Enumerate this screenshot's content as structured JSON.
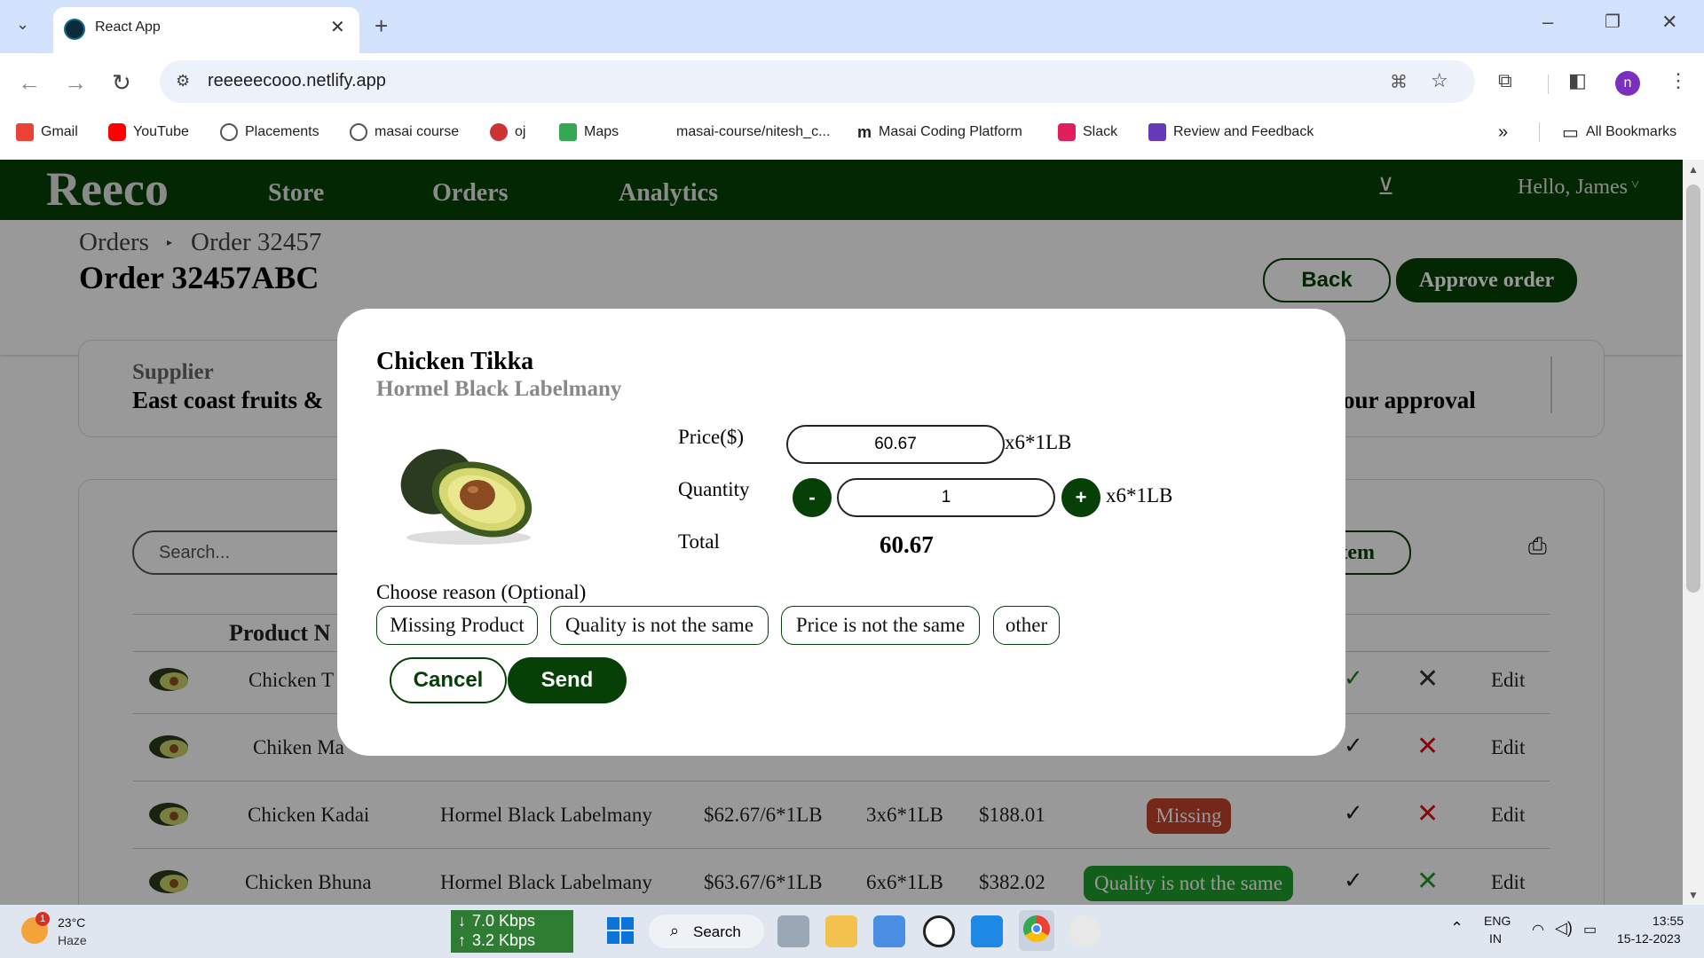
{
  "browser": {
    "tab_title": "React App",
    "url": "reeeeecooo.netlify.app",
    "profile_initial": "n",
    "bookmarks": [
      "Gmail",
      "YouTube",
      "Placements",
      "masai course",
      "oj",
      "Maps",
      "masai-course/nitesh_c...",
      "Masai Coding Platform",
      "Slack",
      "Review and Feedback"
    ],
    "all_bookmarks": "All Bookmarks"
  },
  "app": {
    "logo": "Reeco",
    "nav": [
      "Store",
      "Orders",
      "Analytics"
    ],
    "greeting": "Hello, James",
    "breadcrumb": [
      "Orders",
      "Order 32457"
    ],
    "order_title": "Order 32457ABC",
    "back_label": "Back",
    "approve_label": "Approve order",
    "supplier_label": "Supplier",
    "supplier_value": "East coast fruits &",
    "status_value": "our approval",
    "search_placeholder": "Search...",
    "add_item_partial": "Item",
    "product_header_partial": "Product N",
    "rows": [
      {
        "name": "Chicken T",
        "brand": "",
        "price": "",
        "qty": "",
        "total": "",
        "status": "",
        "edit": "Edit"
      },
      {
        "name": "Chiken Ma",
        "brand": "",
        "price": "",
        "qty": "",
        "total": "",
        "status": "",
        "edit": "Edit"
      },
      {
        "name": "Chicken Kadai",
        "brand": "Hormel Black Labelmany",
        "price": "$62.67/6*1LB",
        "qty": "3x6*1LB",
        "total": "$188.01",
        "status": "Missing",
        "edit": "Edit"
      },
      {
        "name": "Chicken Bhuna",
        "brand": "Hormel Black Labelmany",
        "price": "$63.67/6*1LB",
        "qty": "6x6*1LB",
        "total": "$382.02",
        "status": "Quality is not the same",
        "edit": "Edit"
      }
    ]
  },
  "modal": {
    "title": "Chicken Tikka",
    "subtitle": "Hormel Black Labelmany",
    "price_label": "Price($)",
    "price_value": "60.67",
    "unit": "x6*1LB",
    "quantity_label": "Quantity",
    "quantity_value": "1",
    "minus": "-",
    "plus": "+",
    "total_label": "Total",
    "total_value": "60.67",
    "reason_label": "Choose reason (Optional)",
    "reasons": [
      "Missing Product",
      "Quality is not the same",
      "Price is not the same",
      "other"
    ],
    "cancel_label": "Cancel",
    "send_label": "Send"
  },
  "taskbar": {
    "weather_temp": "23°C",
    "weather_desc": "Haze",
    "weather_badge": "1",
    "net_down": "7.0 Kbps",
    "net_up": "3.2 Kbps",
    "search_label": "Search",
    "lang": "ENG",
    "region": "IN",
    "time": "13:55",
    "date": "15-12-2023"
  },
  "colors": {
    "brand": "#064006",
    "missing_badge": "#c0432a",
    "quality_badge": "#1f9e2c"
  }
}
